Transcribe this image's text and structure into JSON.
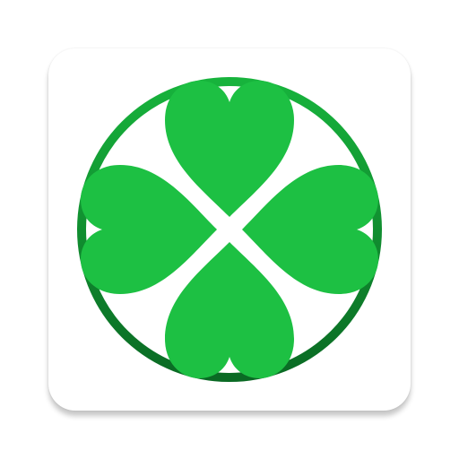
{
  "app_icon": {
    "icon_name": "four-leaf-clover-icon",
    "tile_color": "#ffffff",
    "colors": {
      "ring_top": "#17b33c",
      "ring_bottom": "#0a6a24",
      "leaf_top": "#1dc043",
      "leaf_bottom": "#0a6e24",
      "separator": "#ffffff"
    }
  }
}
